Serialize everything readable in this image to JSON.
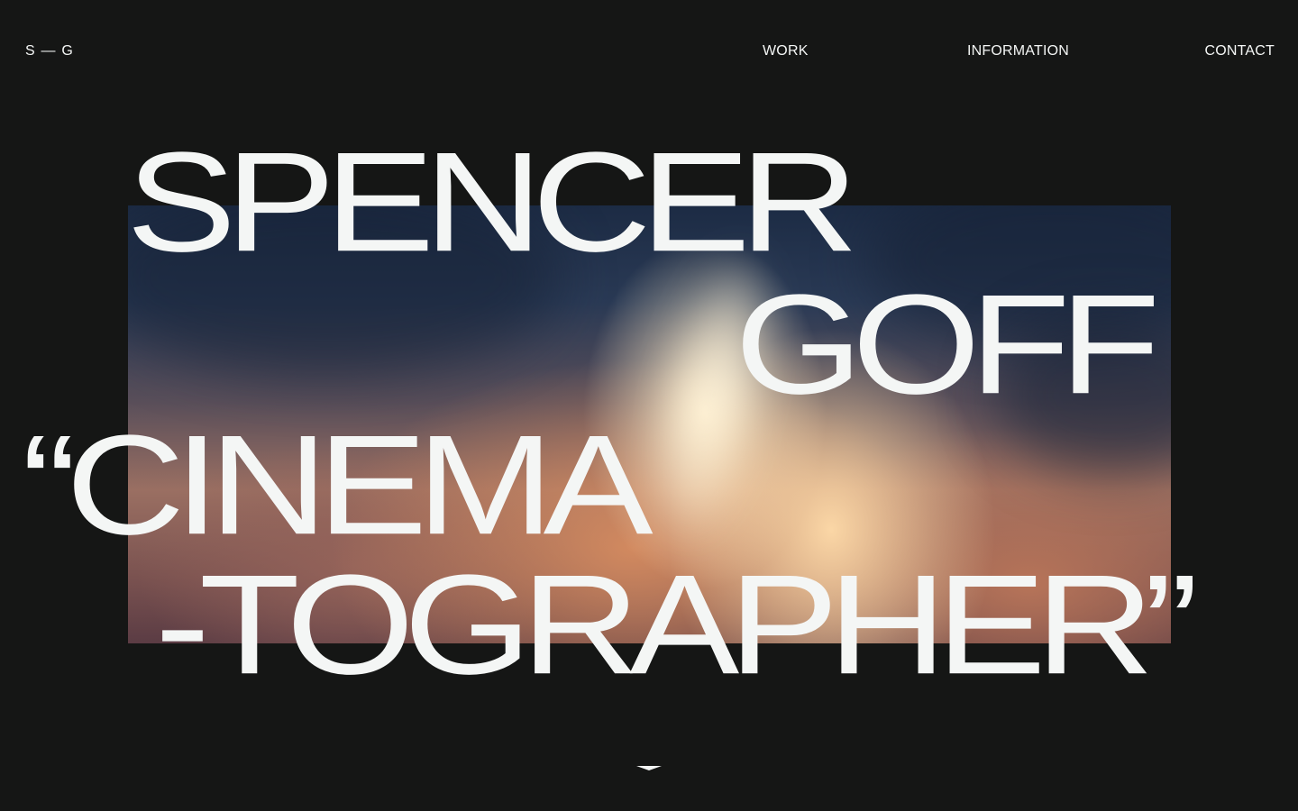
{
  "header": {
    "logo": "S — G",
    "nav": {
      "work": "WORK",
      "information": "INFORMATION",
      "contact": "CONTACT"
    }
  },
  "hero": {
    "lines": [
      "SPENCER",
      "GOFF",
      "“CINEMA",
      "-TOGRAPHER”"
    ]
  },
  "scroll_indicator": {
    "icon": "chevron-down-icon"
  },
  "colors": {
    "background": "#151615",
    "text": "#f4f6f5"
  }
}
